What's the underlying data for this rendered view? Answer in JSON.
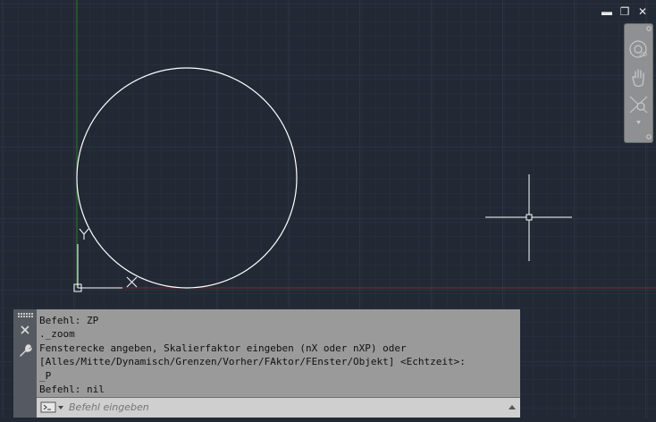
{
  "window_controls": {
    "minimize_label": "▬",
    "restore_label": "❐",
    "close_label": "✕"
  },
  "navigation_bar": {
    "tools": [
      "2d-wheel-icon",
      "pan-hand-icon",
      "zoom-extents-icon",
      "dropdown-arrow-icon"
    ]
  },
  "ucs_icon": {
    "x_label": "X",
    "y_label": "Y"
  },
  "command_window": {
    "history": [
      "Befehl: ZP",
      "._zoom",
      "Fensterecke angeben, Skalierfaktor eingeben (nX oder nXP) oder",
      "[Alles/Mitte/Dynamisch/Grenzen/Vorher/FAktor/FEnster/Objekt] <Echtzeit>:",
      "_P",
      "Befehl: nil"
    ],
    "input_placeholder": "Befehl eingeben",
    "input_value": ""
  },
  "colors": {
    "canvas_background": "#222935",
    "grid_minor": "#2b323e",
    "grid_major": "#353d4a",
    "y_axis": "#2d7a2d",
    "x_axis": "#7a2a2a",
    "geometry": "#ffffff"
  }
}
